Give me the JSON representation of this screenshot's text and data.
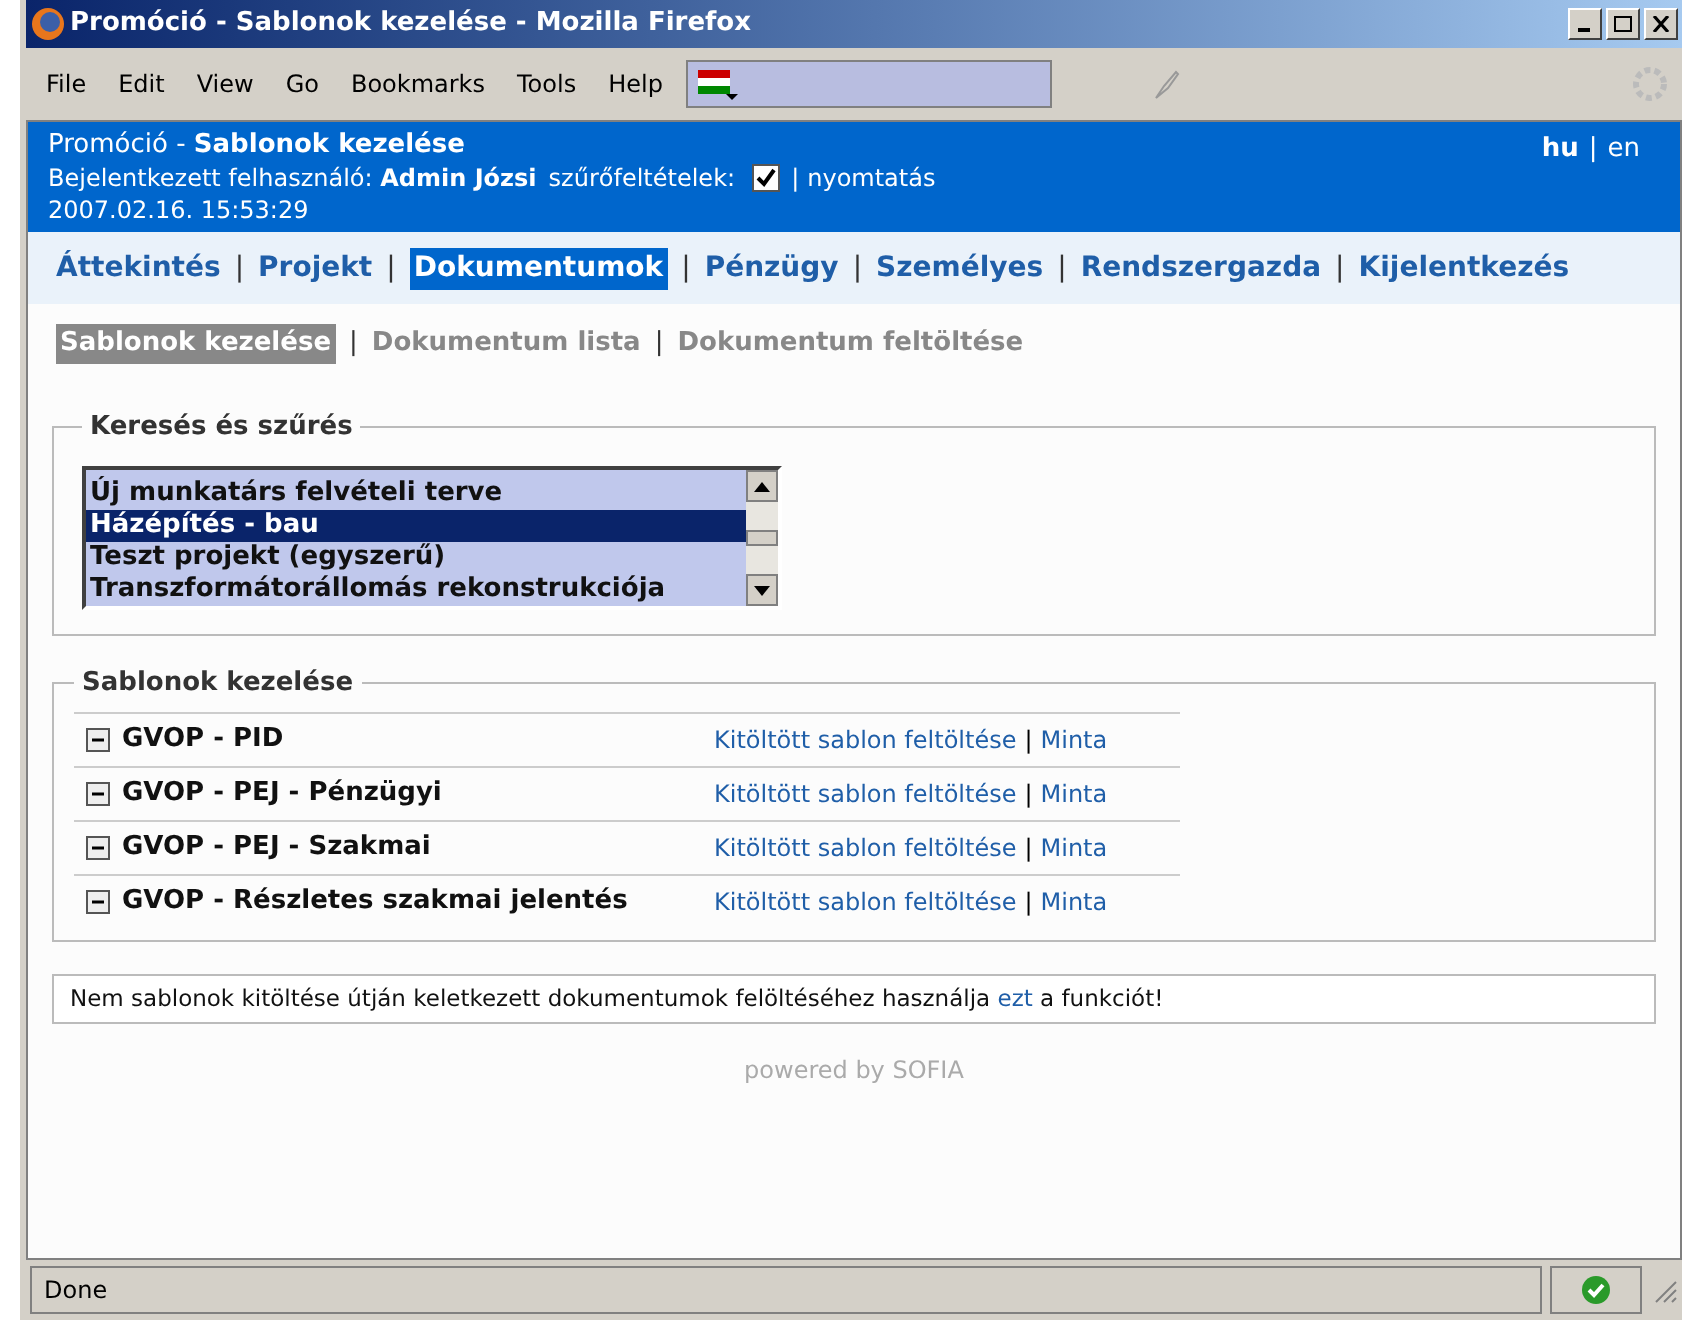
{
  "window": {
    "title": "Promóció - Sablonok kezelése - Mozilla Firefox"
  },
  "menu": [
    "File",
    "Edit",
    "View",
    "Go",
    "Bookmarks",
    "Tools",
    "Help"
  ],
  "header": {
    "title": "Promóció - **Sablonok kezelése**",
    "user": "Bejelentkezett felhasználó: **Admin Józsi**",
    "filter_label": "szűrőfeltételek:",
    "filter_checked": true,
    "separator": "|",
    "print": "nyomtatás",
    "datetime": "2007.02.16. 15:53:29",
    "languages": [
      {
        "label": "hu",
        "selected": true
      },
      {
        "label": "en",
        "selected": false
      }
    ]
  },
  "nav": [
    {
      "label": "Áttekintés",
      "selected": false
    },
    {
      "label": "Projekt",
      "selected": false
    },
    {
      "label": "Dokumentumok",
      "selected": true
    },
    {
      "label": "Pénzügy",
      "selected": false
    },
    {
      "label": "Személyes",
      "selected": false
    },
    {
      "label": "Rendszergazda",
      "selected": false
    },
    {
      "label": "Kijelentkezés",
      "selected": false
    }
  ],
  "subnav": [
    {
      "label": "Sablonok kezelése",
      "selected": true
    },
    {
      "label": "Dokumentum lista",
      "selected": false
    },
    {
      "label": "Dokumentum feltöltése",
      "selected": false
    }
  ],
  "search": {
    "legend": "Keresés és szűrés",
    "projects": [
      {
        "label": "Új munkatárs felvételi terve",
        "selected": false
      },
      {
        "label": "Házépítés - bau",
        "selected": true
      },
      {
        "label": "Teszt projekt (egyszerű)",
        "selected": false
      },
      {
        "label": "Transzformátorállomás rekonstrukciója",
        "selected": false
      }
    ]
  },
  "templates": {
    "legend": "Sablonok kezelése",
    "rows": [
      {
        "name": "GVOP - PID",
        "expanded": true,
        "upload": "Kitöltött sablon feltöltése",
        "sample": "Minta"
      },
      {
        "name": "GVOP - PEJ - Pénzügyi",
        "expanded": true,
        "upload": "Kitöltött sablon feltöltése",
        "sample": "Minta"
      },
      {
        "name": "GVOP - PEJ - Szakmai",
        "expanded": true,
        "upload": "Kitöltött sablon feltöltése",
        "sample": "Minta"
      },
      {
        "name": "GVOP - Részletes szakmai jelentés",
        "expanded": true,
        "upload": "Kitöltött sablon feltöltése",
        "sample": "Minta"
      }
    ]
  },
  "note": {
    "before": "Nem sablonok kitöltése útján keletkezett dokumentumok felöltéséhez használja",
    "link": "ezt",
    "after": "a funkciót!"
  },
  "footer": "powered by SOFIA",
  "status_bar": {
    "text": "Done"
  }
}
